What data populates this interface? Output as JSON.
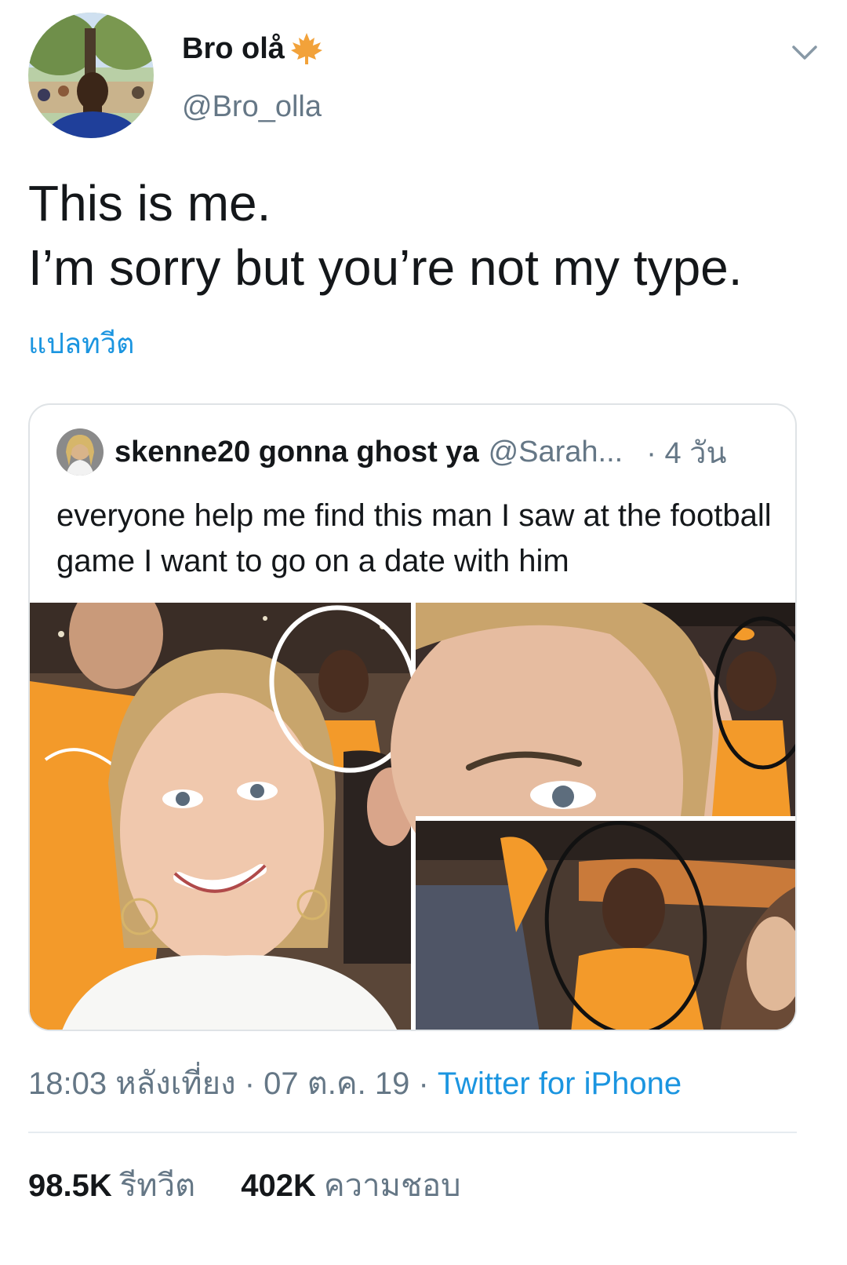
{
  "tweet": {
    "display_name": "Bro olå",
    "name_emoji": "maple-leaf-icon",
    "handle": "@Bro_olla",
    "text_line1": "This is me.",
    "text_line2": "I’m sorry but you’re not my type.",
    "translate_label": "แปลทวีต",
    "timestamp": "18:03 หลังเที่ยง · 07 ต.ค. 19 · ",
    "source": "Twitter for iPhone"
  },
  "quoted": {
    "display_name": "skenne20 gonna ghost ya",
    "handle": "@Sarah...",
    "age": "· 4 วัน",
    "text": "everyone help me find this man I saw at the football game I want to go on a date with him"
  },
  "stats": {
    "retweets_value": "98.5K",
    "retweets_label": "รีทวีต",
    "likes_value": "402K",
    "likes_label": "ความชอบ"
  },
  "colors": {
    "link": "#1b95e0",
    "secondary": "#657786",
    "primary": "#14171a",
    "orange": "#f39a2a"
  }
}
